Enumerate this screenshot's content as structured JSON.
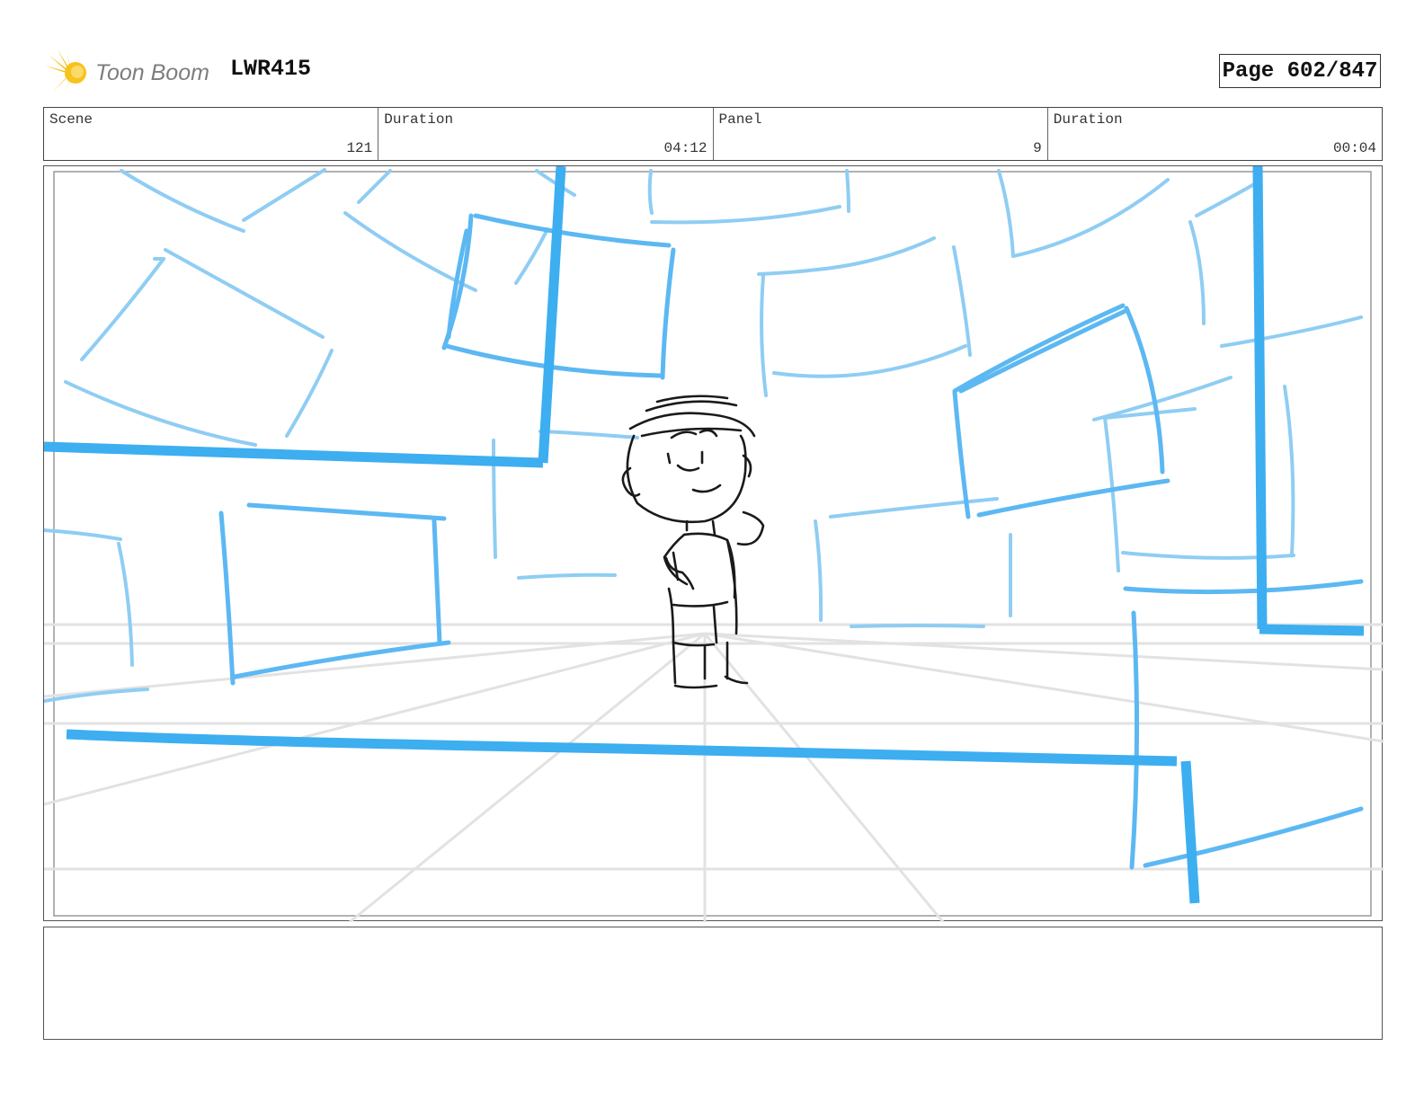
{
  "header": {
    "logo_text": "Toon Boom",
    "project_code": "LWR415",
    "page_label": "Page 602/847"
  },
  "info": {
    "scene_label": "Scene",
    "scene_value": "121",
    "duration_label": "Duration",
    "duration_value": "04:12",
    "panel_label": "Panel",
    "panel_value": "9",
    "panel_duration_label": "Duration",
    "panel_duration_value": "00:04"
  },
  "notes": {
    "text": ""
  },
  "colors": {
    "accent_blue": "#3daef0",
    "light_blue": "#8fcdf3",
    "guide_gray": "#e2e2e2",
    "logo_yellow": "#f7c21b"
  }
}
